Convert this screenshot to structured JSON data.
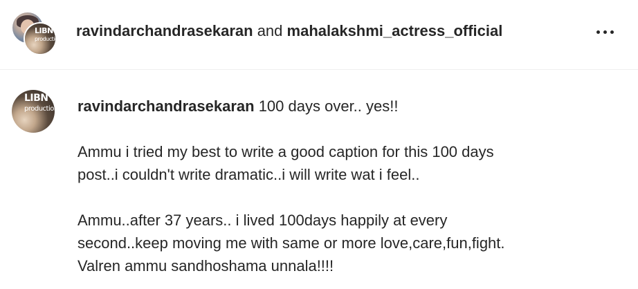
{
  "header": {
    "user1": "ravindarchandrasekaran",
    "connector": " and ",
    "user2": "mahalakshmi_actress_official",
    "more_icon": "more-options-icon"
  },
  "avatar_logo": {
    "line1": "LIBN",
    "line2": "production"
  },
  "post": {
    "username": "ravindarchandrasekaran",
    "first_line": " 100 days over.. yes!!",
    "paragraph2_line1": "Ammu i tried my best to write a good caption for this 100 days",
    "paragraph2_line2": "post..i couldn't write dramatic..i will write wat i feel..",
    "paragraph3_line1": "Ammu..after 37 years.. i lived 100days happily at every",
    "paragraph3_line2": "second..keep moving me with same or more love,care,fun,fight.",
    "paragraph3_line3": "Valren ammu sandhoshama unnala!!!!"
  }
}
